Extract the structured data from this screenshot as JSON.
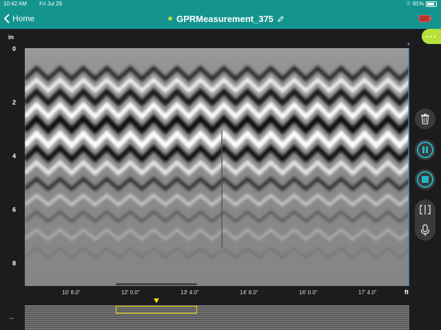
{
  "status_bar": {
    "time": "10:42 AM",
    "date": "Fri Jul 29",
    "battery": "91%"
  },
  "nav": {
    "back_label": "Home",
    "title": "GPRMeasurement_375"
  },
  "axis": {
    "y_unit": "in",
    "y_ticks": [
      "0",
      "2",
      "4",
      "6",
      "8"
    ],
    "x_ticks": [
      "10' 8.0\"",
      "12' 0.0\"",
      "13' 4.0\"",
      "14' 8.0\"",
      "16' 0.0\"",
      "17' 4.0\""
    ],
    "x_unit": "ft"
  },
  "icons": {
    "back": "chevron-left-icon",
    "edit": "pencil-icon",
    "menu": "ellipsis-icon",
    "delete": "trash-icon",
    "pause": "pause-icon",
    "stop": "stop-icon",
    "split": "split-view-icon",
    "mic": "microphone-icon",
    "expand": "arrow-right-icon"
  },
  "colors": {
    "accent": "#14948f",
    "highlight": "#b7e03a",
    "marker": "#f5d90a"
  }
}
